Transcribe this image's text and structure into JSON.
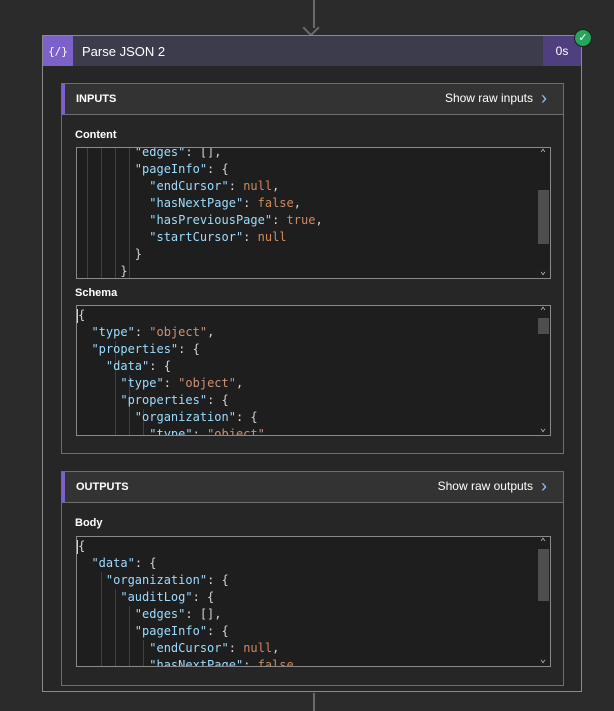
{
  "card": {
    "icon": "{/}",
    "title": "Parse JSON 2",
    "duration": "0s",
    "status": "succeeded"
  },
  "inputs": {
    "header": "INPUTS",
    "show_raw": "Show raw inputs",
    "content_label": "Content",
    "schema_label": "Schema"
  },
  "outputs": {
    "header": "OUTPUTS",
    "show_raw": "Show raw outputs",
    "body_label": "Body"
  },
  "icons": {
    "card": "json-braces-icon",
    "status": "checkmark-icon",
    "expand": "chevron-right-icon",
    "scroll_up": "chevron-up-icon",
    "scroll_down": "chevron-down-icon"
  },
  "colors": {
    "accent": "#7b61c9",
    "success": "#26a65b",
    "key": "#9cdcfe",
    "string": "#ce9178",
    "keyword": "#cf8a5e"
  }
}
